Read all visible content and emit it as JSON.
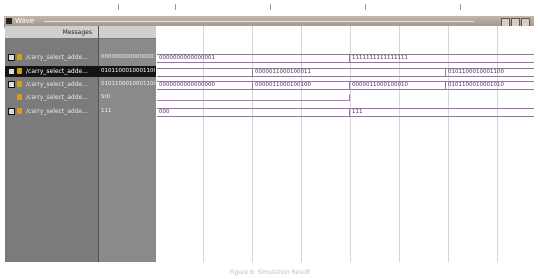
{
  "window": {
    "title": "Wave"
  },
  "header": {
    "messages_label": "Messages"
  },
  "signals": [
    {
      "name": "/carry_select_adde...",
      "value": "0000000000000001",
      "selected": false,
      "kind": "bus"
    },
    {
      "name": "/carry_select_adde...",
      "value": "0101100010001100",
      "selected": true,
      "kind": "bus"
    },
    {
      "name": "/carry_select_adde...",
      "value": "0101100010001100",
      "selected": false,
      "kind": "bus"
    },
    {
      "name": "/carry_select_adde...",
      "value": "St0",
      "selected": false,
      "kind": "bit"
    },
    {
      "name": "/carry_select_adde...",
      "value": "111",
      "selected": false,
      "kind": "bus"
    }
  ],
  "waves": [
    {
      "segments": [
        "0000000000000001",
        "",
        "",
        "1111111111111111",
        "",
        ""
      ]
    },
    {
      "segments": [
        "",
        "0000011000100011",
        "",
        "",
        "0101100010001100",
        ""
      ]
    },
    {
      "segments": [
        "0000000000000000",
        "0000011000100100",
        "",
        "0000011000100010",
        "0101100010001010",
        ""
      ]
    },
    {
      "segments": []
    },
    {
      "segments": [
        "000",
        "",
        "",
        "111",
        "",
        ""
      ]
    }
  ],
  "caption": "Figure 6: Simulation Result",
  "colors": {
    "title_bar": "#b1a599",
    "signal_panel": "#7b7b7b",
    "bus": "#9a6fa8"
  }
}
